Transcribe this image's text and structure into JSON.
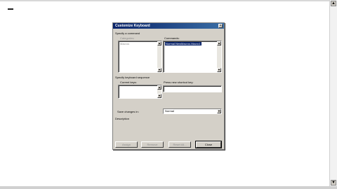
{
  "dialog": {
    "title": "Customize Keyboard",
    "close_glyph": "×",
    "specify_command_label": "Specify a command",
    "categories_label": "Categories:",
    "categories_items": [
      "Macros"
    ],
    "commands_label": "Commands:",
    "commands_items": [
      "Normal.NewMacros.Macro1"
    ],
    "specify_sequence_label": "Specify keyboard sequence",
    "current_keys_label": "Current keys:",
    "current_keys_value": "",
    "new_shortcut_label": "Press new shortcut key:",
    "new_shortcut_value": "",
    "save_changes_label": "Save changes in:",
    "save_changes_value": "Normal",
    "description_label": "Description",
    "buttons": {
      "assign": "Assign",
      "remove": "Remove",
      "reset_all": "Reset All...",
      "close": "Close"
    }
  },
  "scroll_glyphs": {
    "up": "▲",
    "down": "▼"
  }
}
